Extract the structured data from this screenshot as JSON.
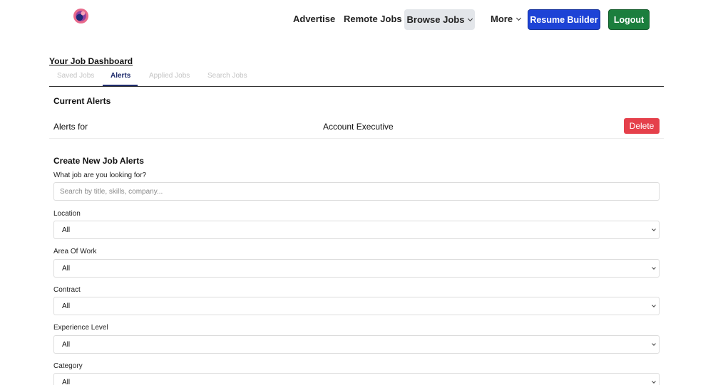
{
  "header": {
    "logo": "app-logo",
    "nav": {
      "advertise": "Advertise",
      "remote_jobs": "Remote Jobs",
      "browse_jobs": "Browse Jobs",
      "more": "More"
    },
    "resume_builder": "Resume Builder",
    "logout": "Logout"
  },
  "dashboard": {
    "title": "Your Job Dashboard",
    "tabs": [
      "Saved Jobs",
      "Alerts",
      "Applied Jobs",
      "Search Jobs"
    ],
    "active_tab": "Alerts"
  },
  "current_alerts": {
    "title": "Current Alerts",
    "row": {
      "label": "Alerts for",
      "value": "Account Executive",
      "delete": "Delete"
    }
  },
  "create_alert": {
    "title": "Create New Job Alerts",
    "search_label": "What job are you looking for?",
    "search_placeholder": "Search by title, skills, company...",
    "fields": [
      {
        "label": "Location",
        "value": "All"
      },
      {
        "label": "Area Of Work",
        "value": "All"
      },
      {
        "label": "Contract",
        "value": "All"
      },
      {
        "label": "Experience Level",
        "value": "All"
      },
      {
        "label": "Category",
        "value": "All"
      }
    ]
  },
  "colors": {
    "resume_button": "#1d43d6",
    "logout_button": "#1b7e3d",
    "delete_button": "#e5404b",
    "browse_button_bg": "#e3e6ea",
    "active_tab": "#1d2a6b"
  }
}
